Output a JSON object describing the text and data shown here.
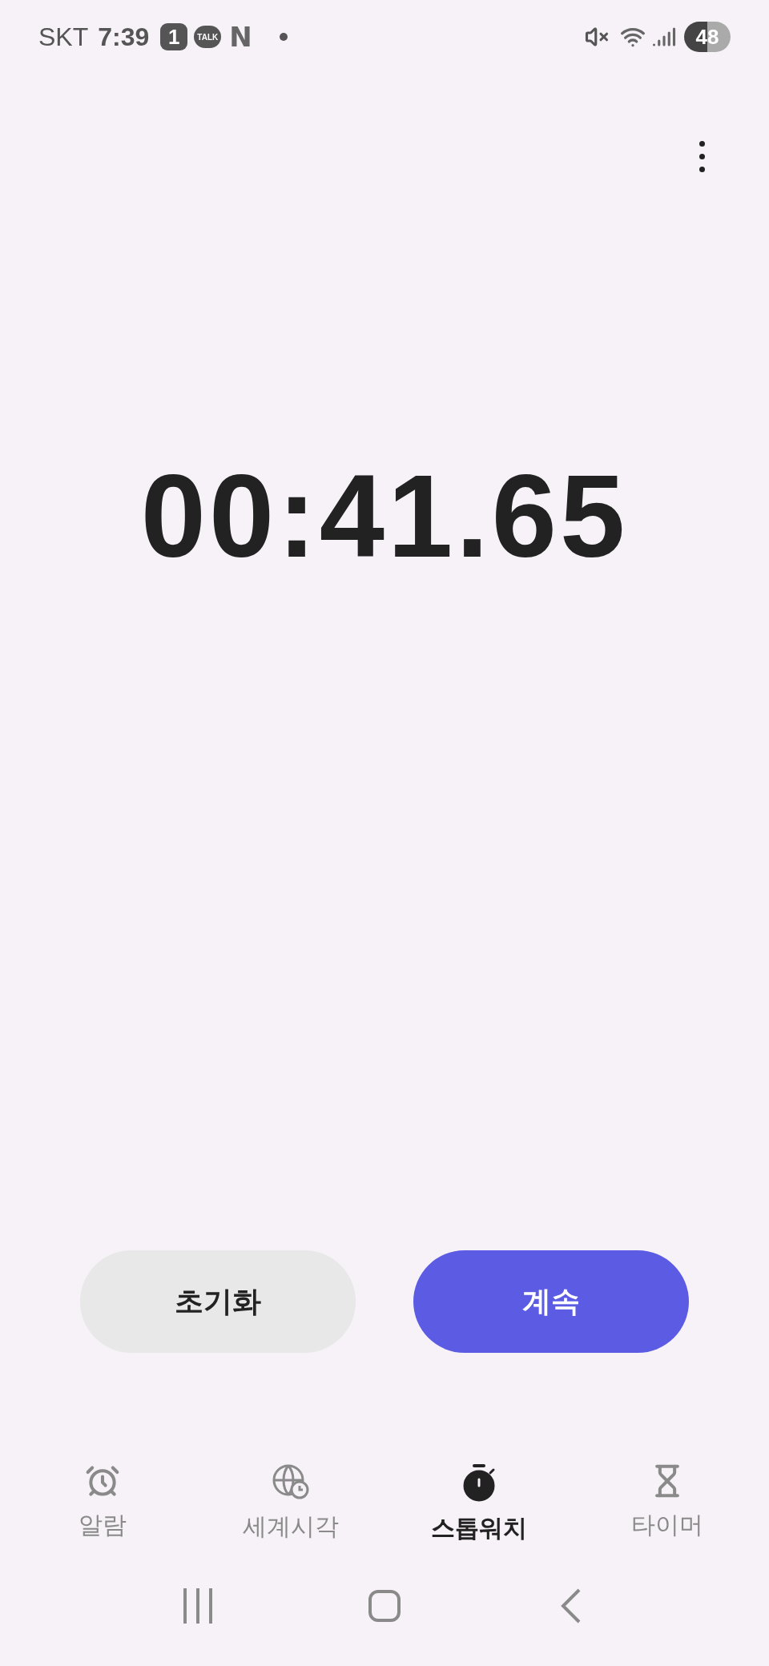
{
  "status_bar": {
    "carrier": "SKT",
    "time": "7:39",
    "notification_badge": "1",
    "chat_badge": "TALK",
    "app_letter": "N",
    "battery": "48"
  },
  "stopwatch": {
    "time": "00:41.65"
  },
  "buttons": [
    {
      "label": "초기화",
      "kind": "secondary"
    },
    {
      "label": "계속",
      "kind": "primary"
    }
  ],
  "tabs": [
    {
      "label": "알람",
      "kind": "alarm",
      "selected": false
    },
    {
      "label": "세계시각",
      "kind": "world",
      "selected": false
    },
    {
      "label": "스톱워치",
      "kind": "stopwatch",
      "selected": true
    },
    {
      "label": "타이머",
      "kind": "timer",
      "selected": false
    }
  ]
}
